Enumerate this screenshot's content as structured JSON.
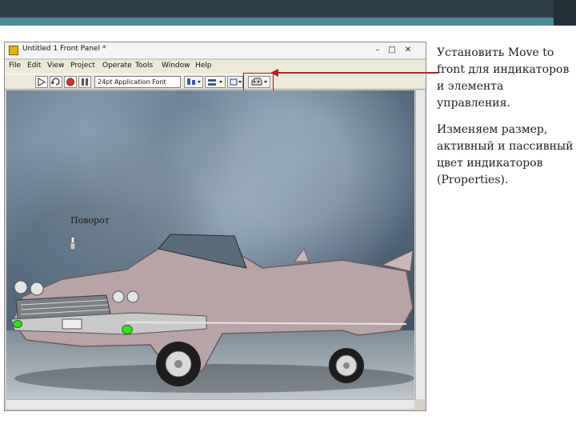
{
  "window": {
    "title": "Untitled 1 Front Panel *",
    "minimize": "–",
    "maximize": "□",
    "close": "✕"
  },
  "menu": [
    "File",
    "Edit",
    "View",
    "Project",
    "Operate",
    "Tools",
    "Window",
    "Help"
  ],
  "toolbar": {
    "font_selector": "24pt Application Font",
    "icons": [
      "run-arrow-icon",
      "run-continuously-icon",
      "abort-icon",
      "pause-icon",
      "align-icon",
      "distribute-icon",
      "resize-icon",
      "reorder-icon"
    ]
  },
  "front_panel": {
    "control_label": "Поворот"
  },
  "slide": {
    "para1": "Установить Move to front для индикаторов и элемента управления.",
    "para2": "Изменяем размер, активный и пассивный цвет индикаторов (Properties)."
  },
  "colors": {
    "header_dark": "#2f3f4a",
    "header_teal": "#4c8a95",
    "highlight": "#cc0000",
    "indicator_on": "#33dd22"
  }
}
